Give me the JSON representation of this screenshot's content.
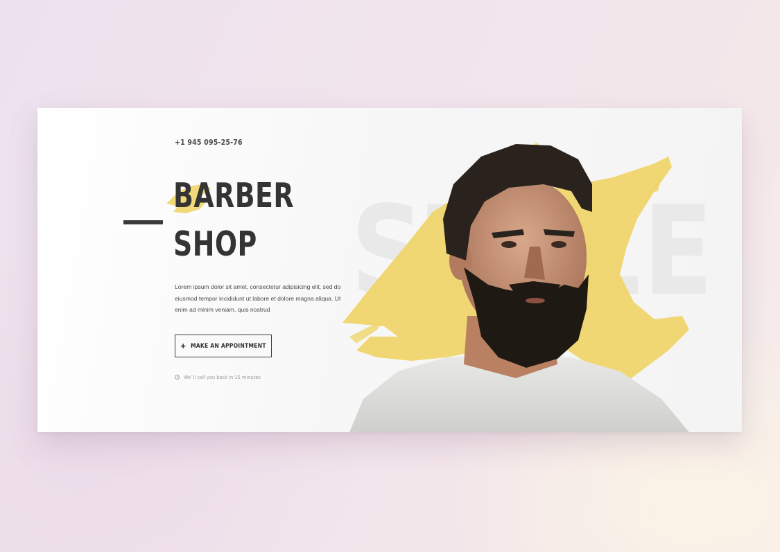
{
  "hero": {
    "phone": "+1 945 095-25-76",
    "title_line1": "BARBER",
    "title_line2": "SHOP",
    "description": "Lorem ipsum dolor sit amet, consectetur adipisicing elit, sed do eiusmod tempor incididunt ut labore et dolore magna aliqua. Ut enim ad minim veniam, quis nostrud",
    "cta": {
      "icon": "plus-icon",
      "label": "MAKE AN APPOINTMENT"
    },
    "note": {
      "icon": "clock-icon",
      "text": "We`ll call you back in 15 minutes"
    },
    "background_word": "STYLE"
  },
  "colors": {
    "accent_yellow": "#efd56c",
    "text_dark": "#343434",
    "card_bg": "#f6f6f6"
  }
}
